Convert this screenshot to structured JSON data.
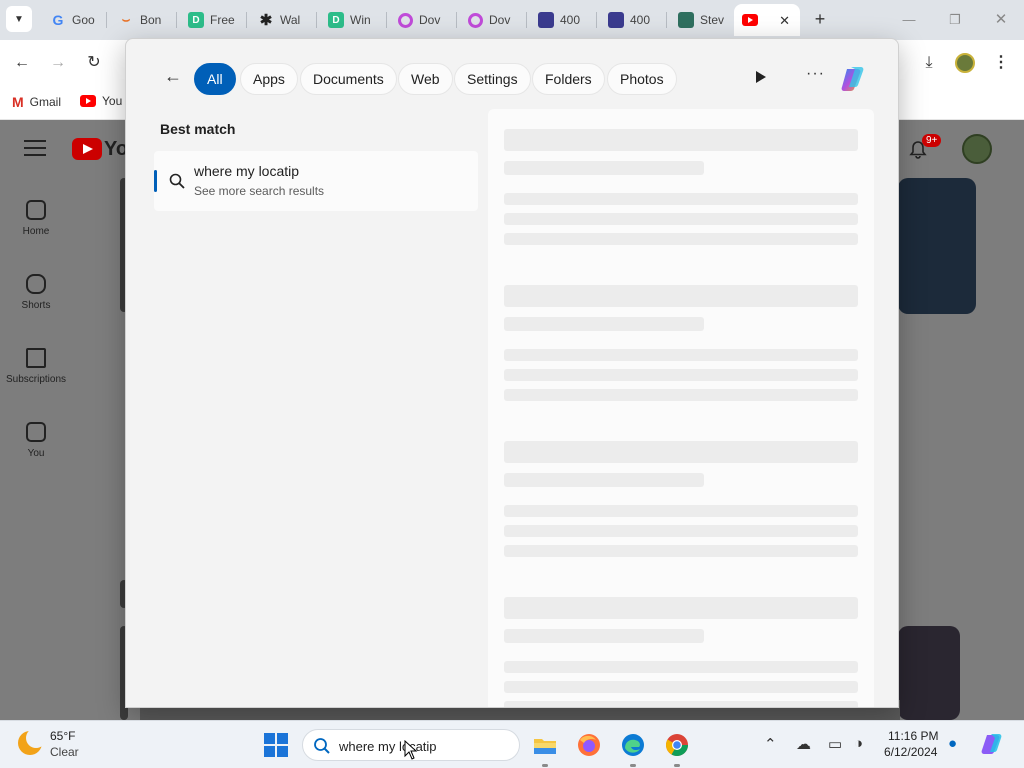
{
  "browser": {
    "tabs": [
      {
        "title": "Goo",
        "icon": "google-icon",
        "color": "#4285f4"
      },
      {
        "title": "Bon",
        "icon": "rainbow-icon",
        "color": "#e9742b"
      },
      {
        "title": "Free",
        "icon": "d-icon",
        "color": "#2dbd8a"
      },
      {
        "title": "Wal",
        "icon": "star-icon",
        "color": "#222222"
      },
      {
        "title": "Win",
        "icon": "d-icon",
        "color": "#2dbd8a"
      },
      {
        "title": "Dov",
        "icon": "ring-icon",
        "color": "#e040fb"
      },
      {
        "title": "Dov",
        "icon": "ring-icon",
        "color": "#e040fb"
      },
      {
        "title": "400",
        "icon": "image-icon",
        "color": "#3b3b8f"
      },
      {
        "title": "400",
        "icon": "image-icon",
        "color": "#3b3b8f"
      },
      {
        "title": "Stev",
        "icon": "app-icon",
        "color": "#2f6f5f"
      },
      {
        "title": "",
        "icon": "youtube-icon",
        "color": "#ff0000",
        "active": true
      }
    ],
    "new_tab": "+",
    "bookmarks": [
      {
        "label": "Gmail"
      },
      {
        "label": "You"
      }
    ]
  },
  "youtube": {
    "logo_text": "You",
    "notification_count": "9+",
    "sidebar": [
      {
        "label": "Home"
      },
      {
        "label": "Shorts"
      },
      {
        "label": "Subscriptions"
      },
      {
        "label": "You"
      }
    ]
  },
  "search_flyout": {
    "filters": [
      "All",
      "Apps",
      "Documents",
      "Web",
      "Settings",
      "Folders",
      "Photos"
    ],
    "active_filter": "All",
    "best_match_heading": "Best match",
    "result": {
      "title": "where my locatip",
      "subtitle": "See more search results"
    }
  },
  "taskbar": {
    "weather": {
      "temp": "65°F",
      "condition": "Clear"
    },
    "search_query": "where my locatip",
    "time": "11:16 PM",
    "date": "6/12/2024"
  },
  "colors": {
    "accent": "#005fb8",
    "youtube_red": "#ff0000",
    "windows_blue": "#1b74d8"
  }
}
